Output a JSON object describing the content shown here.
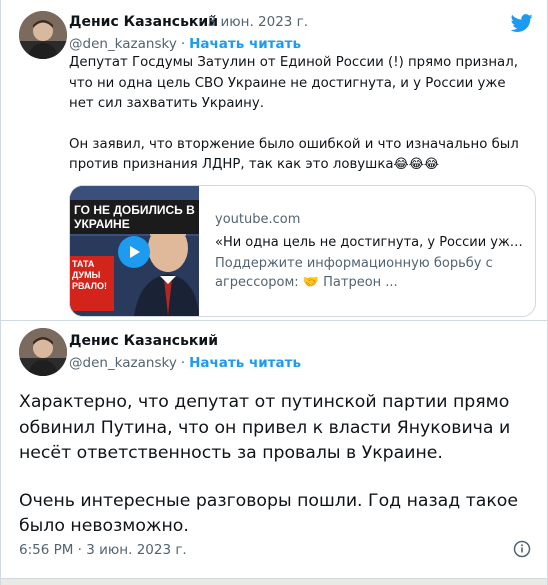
{
  "tweet1": {
    "author_name": "Денис Казанський",
    "date": "3 июн. 2023 г.",
    "handle": "@den_kazansky",
    "follow_label": "Начать читать",
    "paragraph1": "Депутат Госдумы Затулин от Единой России (!) прямо признал, что ни одна цель СВО Украине не достигнута, и у России уже нет сил захватить Украину.",
    "paragraph2": "Он заявил, что вторжение было ошибкой и что изначально был против признания ЛДНР, так как это ловушка",
    "emojis": "😂😂😂",
    "card": {
      "thumb_headline": "ГО НЕ ДОБИЛИСЬ В УКРАИНЕ",
      "thumb_red_text": "ТАТА ДУМЫ РВАЛО!",
      "domain": "youtube.com",
      "title": "«Ни одна цель не достигнута, у России уже…",
      "description": "Поддержите информационную борьбу с агрессором: 🤝 Патреон ..."
    }
  },
  "tweet2": {
    "author_name": "Денис Казанський",
    "handle": "@den_kazansky",
    "follow_label": "Начать читать",
    "paragraph1": "Характерно, что депутат от путинской партии прямо обвинил Путина, что он привел к власти Януковича и несёт ответственность за провалы в Украине.",
    "paragraph2": "Очень интересные разговоры пошли. Год назад такое было невозможно.",
    "timestamp": "6:56 PM · 3 июн. 2023 г."
  },
  "separator": "·",
  "colors": {
    "accent": "#1d9bf0",
    "secondary_text": "#536471",
    "primary_text": "#0f1419",
    "border": "#cfd9de"
  },
  "icons": {
    "brand": "twitter-bird-icon",
    "info": "info-icon",
    "play": "play-icon"
  }
}
